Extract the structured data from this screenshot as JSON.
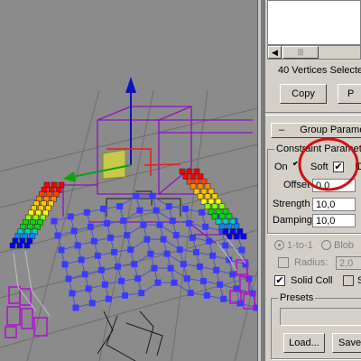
{
  "panel": {
    "vertices_selected": "40 Vertices Selecte",
    "copy_label": "Copy",
    "paste_label_partial": "P",
    "group_rollout_title": "Group Parame",
    "constraint_group_title": "Constraint Paramet",
    "on_label": "On",
    "soft_label": "Soft",
    "id_label_partial": "ID",
    "offset_label": "Offset",
    "offset_value": "0,0",
    "strength_label": "Strength",
    "strength_value": "10,0",
    "damping_label": "Damping",
    "damping_value": "10,0",
    "one_to_one_label": "1-to-1",
    "blob_label": "Blob",
    "radius_label": "Radius:",
    "radius_value": "2,0",
    "solid_coll_label": "Solid Coll",
    "s_label_partial": "S",
    "presets_title": "Presets",
    "load_label": "Load...",
    "save_label_partial": "Save",
    "check_mark": "✔",
    "minus_sign": "–"
  },
  "colors": {
    "panel_bg": "#d4d0c8",
    "viewport_bg": "#8b8b8b",
    "highlight_circle": "#d01010",
    "gizmo_y": "#1010c0",
    "gizmo_x": "#e02020",
    "gizmo_z": "#10a010",
    "wire_purple": "#9010c0",
    "vertex_blue": "#3a3aff"
  },
  "icons": {
    "scroll_left": "scroll-left-arrow-icon",
    "scroll_thumb": "scroll-thumb-grip-icon",
    "rollout_toggle": "rollout-minus-icon"
  }
}
